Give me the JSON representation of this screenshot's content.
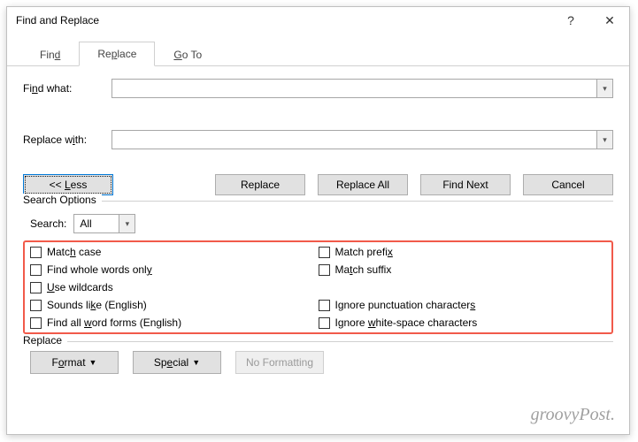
{
  "title": "Find and Replace",
  "titlebar": {
    "help": "?",
    "close": "✕"
  },
  "tabs": {
    "find": "Find",
    "replace": "Replace",
    "goto": "Go To"
  },
  "labels": {
    "find_what": "Find what:",
    "replace_with": "Replace with:"
  },
  "buttons": {
    "less": "<< Less",
    "replace": "Replace",
    "replace_all": "Replace All",
    "find_next": "Find Next",
    "cancel": "Cancel",
    "format": "Format",
    "special": "Special",
    "no_formatting": "No Formatting"
  },
  "search_options": {
    "legend": "Search Options",
    "search_label": "Search:",
    "search_value": "All",
    "left": [
      {
        "pre": "",
        "u": "",
        "post": "Match case"
      },
      {
        "pre": "Find whole words onl",
        "u": "y",
        "post": ""
      },
      {
        "pre": "",
        "u": "U",
        "post": "se wildcards"
      },
      {
        "pre": "Sounds li",
        "u": "k",
        "post": "e (English)"
      },
      {
        "pre": "Find all ",
        "u": "w",
        "post": "ord forms (English)"
      }
    ],
    "right": [
      {
        "pre": "Match prefi",
        "u": "x",
        "post": ""
      },
      {
        "pre": "Ma",
        "u": "t",
        "post": "ch suffix"
      },
      {
        "pre": "",
        "u": "",
        "post": ""
      },
      {
        "pre": "Ignore punctuation character",
        "u": "s",
        "post": ""
      },
      {
        "pre": "Ignore ",
        "u": "w",
        "post": "hite-space characters"
      }
    ]
  },
  "replace_section": {
    "legend": "Replace"
  },
  "watermark": "groovyPost."
}
